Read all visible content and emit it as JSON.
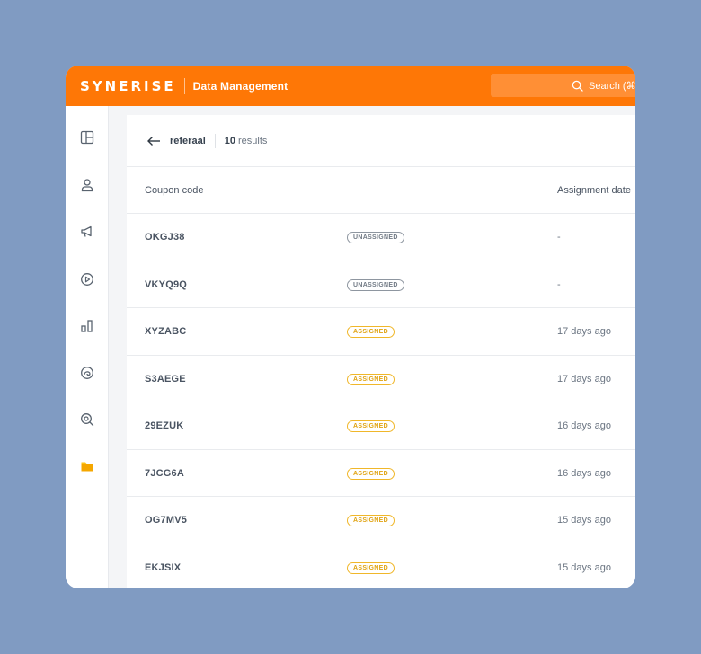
{
  "header": {
    "logo": "SYNERISE",
    "section_title": "Data Management",
    "search_label": "Search (⌘",
    "accent_color": "#fe7706"
  },
  "sidebar": {
    "items": [
      {
        "icon": "dashboard-icon"
      },
      {
        "icon": "user-icon"
      },
      {
        "icon": "megaphone-icon"
      },
      {
        "icon": "play-circle-icon"
      },
      {
        "icon": "analytics-icon"
      },
      {
        "icon": "ai-icon"
      },
      {
        "icon": "search-settings-icon"
      },
      {
        "icon": "folder-icon",
        "active": true
      }
    ]
  },
  "panel": {
    "back_label": "referaal",
    "results_count": "10",
    "results_label": "results",
    "columns": {
      "code": "Coupon code",
      "assignment_date": "Assignment date"
    },
    "rows": [
      {
        "code": "OKGJ38",
        "status": "UNASSIGNED",
        "date": "-"
      },
      {
        "code": "VKYQ9Q",
        "status": "UNASSIGNED",
        "date": "-"
      },
      {
        "code": "XYZABC",
        "status": "ASSIGNED",
        "date": "17 days ago"
      },
      {
        "code": "S3AEGE",
        "status": "ASSIGNED",
        "date": "17 days ago"
      },
      {
        "code": "29EZUK",
        "status": "ASSIGNED",
        "date": "16 days ago"
      },
      {
        "code": "7JCG6A",
        "status": "ASSIGNED",
        "date": "16 days ago"
      },
      {
        "code": "OG7MV5",
        "status": "ASSIGNED",
        "date": "15 days ago"
      },
      {
        "code": "EKJSIX",
        "status": "ASSIGNED",
        "date": "15 days ago"
      }
    ]
  }
}
